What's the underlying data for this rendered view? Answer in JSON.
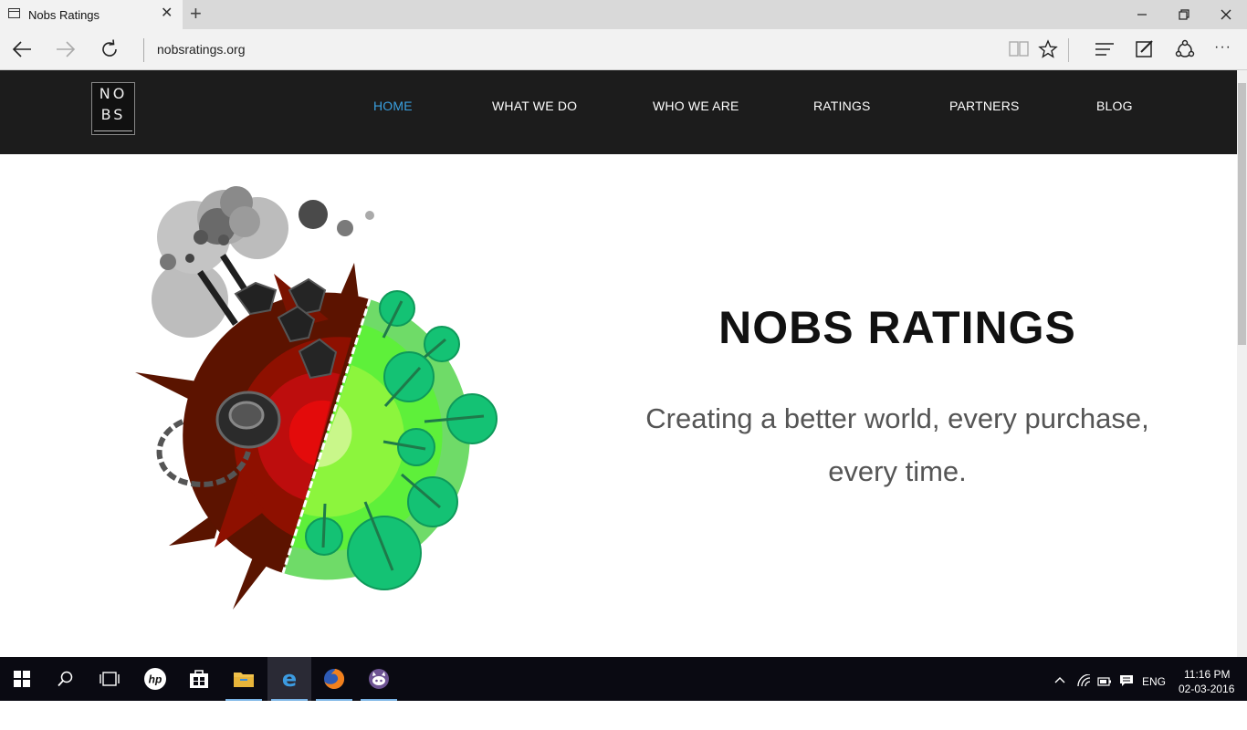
{
  "browser": {
    "tab": {
      "title": "Nobs Ratings",
      "close_glyph": "✕"
    },
    "new_tab_glyph": "+",
    "window_controls": {
      "minimize": "—",
      "restore": "❐",
      "close": "✕"
    },
    "url": "nobsratings.org",
    "toolbar_icons": [
      "reading-view-icon",
      "favorite-star-icon",
      "hub-icon",
      "web-note-icon",
      "share-icon",
      "more-icon"
    ],
    "more_glyph": "···"
  },
  "site": {
    "logo": {
      "top": "NO",
      "bottom": "BS"
    },
    "nav": [
      {
        "label": "HOME",
        "active": true
      },
      {
        "label": "WHAT WE DO",
        "active": false
      },
      {
        "label": "WHO WE ARE",
        "active": false
      },
      {
        "label": "RATINGS",
        "active": false
      },
      {
        "label": "PARTNERS",
        "active": false
      },
      {
        "label": "BLOG",
        "active": false
      }
    ],
    "hero": {
      "title": "NOBS RATINGS",
      "subtitle_line1": "Creating a better world, every purchase,",
      "subtitle_line2": "every time."
    }
  },
  "taskbar": {
    "apps": [
      "start-icon",
      "search-icon",
      "task-view-icon",
      "hp-icon",
      "store-icon",
      "file-explorer-icon",
      "edge-icon",
      "firefox-icon",
      "github-icon"
    ],
    "active_app": "edge-icon",
    "tray": {
      "language": "ENG",
      "time": "11:16 PM",
      "date": "02-03-2016"
    }
  },
  "colors": {
    "nav_bg": "#1c1c1c",
    "nav_active": "#3aa0e0",
    "taskbar_bg": "#0a0a12"
  }
}
